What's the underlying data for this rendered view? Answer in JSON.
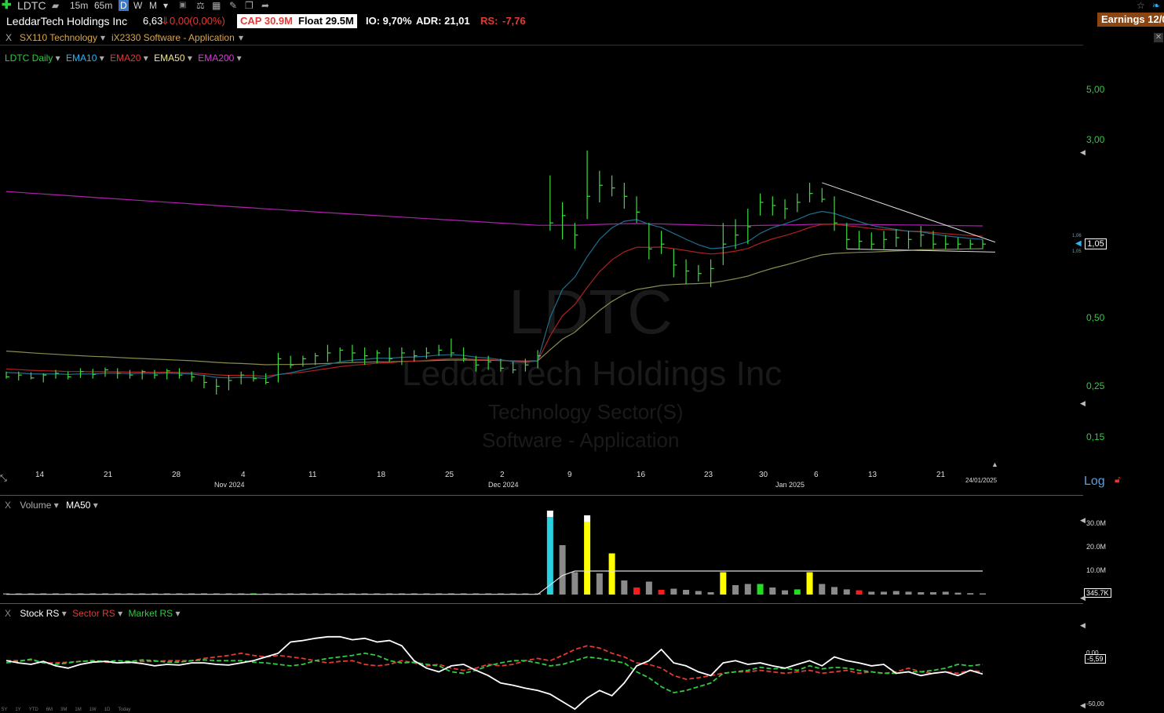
{
  "toolbar": {
    "symbol": "LDTC",
    "timeframes": [
      "15m",
      "65m",
      "D",
      "W",
      "M"
    ],
    "active_timeframe": "D",
    "earnings_label": "Earnings 12/0"
  },
  "info": {
    "company": "LeddarTech Holdings Inc",
    "price": "6,63",
    "change": "0,00(0,00%)",
    "cap_label": "CAP",
    "cap_value": "30.9M",
    "float_label": "Float",
    "float_value": "29.5M",
    "io": "IO: 9,70%",
    "adr": "ADR: 21,01",
    "rs_label": "RS:",
    "rs_value": "-7,76"
  },
  "sector_bar": {
    "close": "X",
    "sector": "SX110 Technology",
    "industry": "iX2330 Software - Application"
  },
  "price_panel": {
    "legend": [
      {
        "label": "LDTC Daily",
        "color": "#2ecc40"
      },
      {
        "label": "EMA10",
        "color": "#29b6f6"
      },
      {
        "label": "EMA20",
        "color": "#e53935"
      },
      {
        "label": "EMA50",
        "color": "#f0e68c"
      },
      {
        "label": "EMA200",
        "color": "#d63fd6"
      }
    ],
    "y_ticks": [
      {
        "label": "5,00",
        "value": 5.0
      },
      {
        "label": "3,00",
        "value": 3.0
      },
      {
        "label": "0,50",
        "value": 0.5
      },
      {
        "label": "0,25",
        "value": 0.25
      },
      {
        "label": "0,15",
        "value": 0.15
      }
    ],
    "last_price_label": "1,05",
    "last_price_small_hi": "1,06",
    "last_price_small_lo": "1,05",
    "x_days": [
      "14",
      "21",
      "28",
      "4",
      "11",
      "18",
      "25",
      "2",
      "9",
      "16",
      "23",
      "30",
      "6",
      "13",
      "21"
    ],
    "x_months": [
      "Nov 2024",
      "Dec 2024",
      "Jan 2025"
    ],
    "date_label": "24/01/2025",
    "log_label": "Log",
    "watermark_symbol": "LDTC",
    "watermark_company": "LeddarTech Holdings Inc",
    "watermark_sector": "Technology Sector(S)",
    "watermark_industry": "Software - Application"
  },
  "volume_panel": {
    "close": "X",
    "title": "Volume",
    "ma_label": "MA50",
    "y_ticks": [
      "30.0M",
      "20.0M",
      "10.0M"
    ],
    "last_volume": "345.7K"
  },
  "rs_panel": {
    "close": "X",
    "legend": [
      {
        "label": "Stock RS",
        "color": "#ffffff"
      },
      {
        "label": "Sector RS",
        "color": "#e53935"
      },
      {
        "label": "Market RS",
        "color": "#2ecc40"
      }
    ],
    "y_top": "0,00",
    "y_bottom": "-50,00",
    "last_value": "-5,59",
    "ranges": [
      "5Y",
      "1Y",
      "YTD",
      "6M",
      "3M",
      "1M",
      "1W",
      "1D",
      "Today"
    ]
  },
  "chart_data": {
    "type": "bar",
    "scale": "log",
    "ylim": [
      0.12,
      6.5
    ],
    "bars": [
      [
        0.27,
        0.29,
        0.275
      ],
      [
        0.265,
        0.29,
        0.28
      ],
      [
        0.268,
        0.288,
        0.272
      ],
      [
        0.26,
        0.285,
        0.28
      ],
      [
        0.27,
        0.295,
        0.285
      ],
      [
        0.268,
        0.29,
        0.275
      ],
      [
        0.272,
        0.3,
        0.29
      ],
      [
        0.27,
        0.298,
        0.282
      ],
      [
        0.275,
        0.302,
        0.295
      ],
      [
        0.27,
        0.3,
        0.285
      ],
      [
        0.27,
        0.295,
        0.28
      ],
      [
        0.268,
        0.295,
        0.29
      ],
      [
        0.27,
        0.295,
        0.28
      ],
      [
        0.268,
        0.298,
        0.292
      ],
      [
        0.27,
        0.3,
        0.28
      ],
      [
        0.262,
        0.29,
        0.275
      ],
      [
        0.245,
        0.28,
        0.26
      ],
      [
        0.23,
        0.27,
        0.25
      ],
      [
        0.24,
        0.28,
        0.265
      ],
      [
        0.255,
        0.29,
        0.28
      ],
      [
        0.262,
        0.292,
        0.27
      ],
      [
        0.255,
        0.285,
        0.26
      ],
      [
        0.26,
        0.35,
        0.33
      ],
      [
        0.3,
        0.34,
        0.31
      ],
      [
        0.305,
        0.34,
        0.33
      ],
      [
        0.31,
        0.35,
        0.34
      ],
      [
        0.32,
        0.38,
        0.35
      ],
      [
        0.32,
        0.37,
        0.36
      ],
      [
        0.32,
        0.38,
        0.35
      ],
      [
        0.31,
        0.37,
        0.34
      ],
      [
        0.315,
        0.36,
        0.35
      ],
      [
        0.32,
        0.37,
        0.33
      ],
      [
        0.31,
        0.37,
        0.35
      ],
      [
        0.32,
        0.36,
        0.34
      ],
      [
        0.33,
        0.37,
        0.35
      ],
      [
        0.34,
        0.38,
        0.36
      ],
      [
        0.335,
        0.405,
        0.35
      ],
      [
        0.32,
        0.37,
        0.33
      ],
      [
        0.29,
        0.34,
        0.31
      ],
      [
        0.295,
        0.34,
        0.32
      ],
      [
        0.29,
        0.33,
        0.3
      ],
      [
        0.285,
        0.32,
        0.295
      ],
      [
        0.29,
        0.33,
        0.31
      ],
      [
        0.3,
        0.36,
        0.34
      ],
      [
        1.2,
        2.1,
        1.3
      ],
      [
        1.1,
        1.6,
        1.4
      ],
      [
        1.0,
        1.3,
        1.15
      ],
      [
        1.35,
        2.7,
        1.7
      ],
      [
        1.6,
        2.2,
        1.9
      ],
      [
        1.7,
        2.1,
        1.85
      ],
      [
        1.5,
        1.95,
        1.7
      ],
      [
        1.3,
        1.7,
        1.45
      ],
      [
        0.9,
        1.3,
        1.0
      ],
      [
        0.95,
        1.2,
        1.05
      ],
      [
        0.75,
        1.0,
        0.85
      ],
      [
        0.7,
        0.9,
        0.8
      ],
      [
        0.72,
        0.85,
        0.78
      ],
      [
        0.68,
        0.9,
        0.82
      ],
      [
        0.85,
        1.3,
        1.05
      ],
      [
        1.0,
        1.35,
        1.15
      ],
      [
        1.05,
        1.5,
        1.25
      ],
      [
        1.4,
        1.75,
        1.6
      ],
      [
        1.4,
        1.7,
        1.55
      ],
      [
        1.35,
        1.65,
        1.5
      ],
      [
        1.45,
        1.75,
        1.6
      ],
      [
        1.6,
        1.95,
        1.75
      ],
      [
        1.6,
        1.85,
        1.65
      ],
      [
        1.2,
        1.7,
        1.3
      ],
      [
        1.0,
        1.3,
        1.1
      ],
      [
        1.0,
        1.2,
        1.08
      ],
      [
        1.0,
        1.18,
        1.05
      ],
      [
        1.0,
        1.2,
        1.1
      ],
      [
        1.02,
        1.22,
        1.12
      ],
      [
        1.0,
        1.2,
        1.1
      ],
      [
        1.02,
        1.26,
        1.15
      ],
      [
        1.0,
        1.2,
        1.05
      ],
      [
        1.0,
        1.15,
        1.05
      ],
      [
        1.0,
        1.12,
        1.05
      ],
      [
        1.0,
        1.1,
        1.05
      ],
      [
        1.0,
        1.1,
        1.05
      ]
    ],
    "ema_pixels_note": "",
    "volume": [
      0,
      0,
      0,
      0,
      0,
      0,
      0,
      0,
      0,
      0,
      0,
      0,
      0,
      0,
      0,
      0,
      0,
      0,
      0,
      0,
      0.3,
      0,
      0.12,
      0,
      0,
      0,
      0,
      0,
      0,
      0,
      0,
      0,
      0,
      0,
      0,
      0,
      0,
      0,
      0,
      0,
      0,
      0,
      0,
      0.3,
      33,
      21,
      9.5,
      31,
      9,
      17.5,
      6,
      3,
      5.5,
      2,
      2.5,
      2,
      1.5,
      1,
      9.5,
      4,
      4.5,
      4.5,
      3,
      1.8,
      2.2,
      9.5,
      4.5,
      3.2,
      2.2,
      1.8,
      1.2,
      1.2,
      1.5,
      1.2,
      1.0,
      1.0,
      1.2,
      0.8,
      0.6,
      0.35
    ]
  }
}
